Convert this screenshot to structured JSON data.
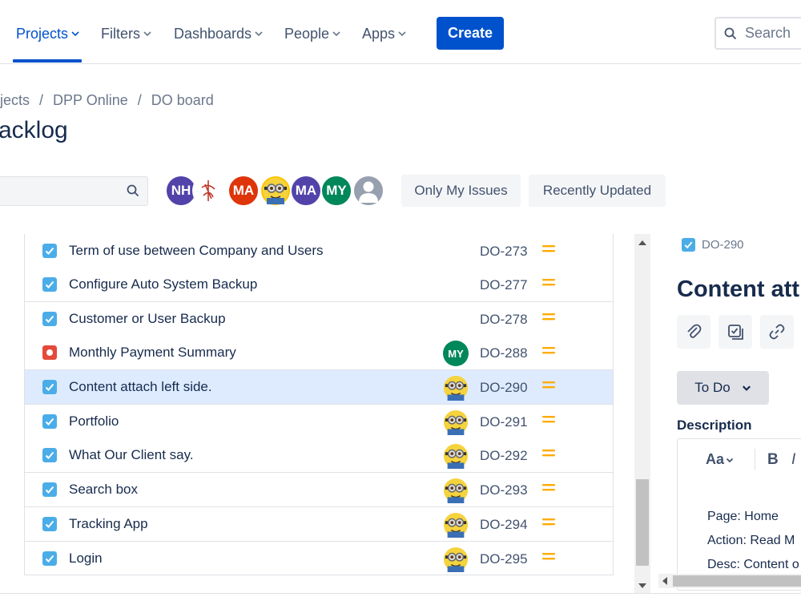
{
  "nav": {
    "items": [
      {
        "label": "Projects",
        "active": true
      },
      {
        "label": "Filters",
        "active": false
      },
      {
        "label": "Dashboards",
        "active": false
      },
      {
        "label": "People",
        "active": false
      },
      {
        "label": "Apps",
        "active": false
      }
    ],
    "create_label": "Create",
    "search_placeholder": "Search"
  },
  "breadcrumb": [
    "jects",
    "/",
    "DPP Online",
    "/",
    "DO board"
  ],
  "page_title": "acklog",
  "filters": {
    "avatars": [
      {
        "initials": "NH",
        "color": "#5243aa"
      },
      {
        "initials": "",
        "color": "#ffffff"
      },
      {
        "initials": "MA",
        "color": "#de350b"
      },
      {
        "initials": "",
        "color": "#ffc400"
      },
      {
        "initials": "MA",
        "color": "#5243aa"
      },
      {
        "initials": "MY",
        "color": "#00875a"
      },
      {
        "initials": "",
        "color": "#97a0af"
      }
    ],
    "only_my_issues": "Only My Issues",
    "recently_updated": "Recently Updated"
  },
  "issues": [
    {
      "summary": "Term of use between Company and Users",
      "key": "DO-273",
      "type": "task",
      "assignee": ""
    },
    {
      "summary": "Configure Auto System Backup",
      "key": "DO-277",
      "type": "task",
      "assignee": ""
    },
    {
      "summary": "Customer or User Backup",
      "key": "DO-278",
      "type": "task",
      "assignee": ""
    },
    {
      "summary": "Monthly Payment Summary",
      "key": "DO-288",
      "type": "bug",
      "assignee": "MY"
    },
    {
      "summary": "Content attach left side.",
      "key": "DO-290",
      "type": "task",
      "assignee": "minion",
      "selected": true
    },
    {
      "summary": "Portfolio",
      "key": "DO-291",
      "type": "task",
      "assignee": "minion"
    },
    {
      "summary": "What Our Client say.",
      "key": "DO-292",
      "type": "task",
      "assignee": "minion"
    },
    {
      "summary": "Search box",
      "key": "DO-293",
      "type": "task",
      "assignee": "minion"
    },
    {
      "summary": "Tracking App",
      "key": "DO-294",
      "type": "task",
      "assignee": "minion"
    },
    {
      "summary": "Login",
      "key": "DO-295",
      "type": "task",
      "assignee": "minion"
    }
  ],
  "detail": {
    "issue_key": "DO-290",
    "title": "Content att",
    "status": "To Do",
    "description_label": "Description",
    "editor": {
      "text_style": "Aa",
      "bold": "B",
      "italic": "I",
      "lines": [
        "Page: Home",
        "Action: Read M",
        "Desc: Content o"
      ]
    }
  },
  "colors": {
    "primary": "#0052cc",
    "task": "#4bade8",
    "bug": "#e5493a",
    "priority_medium": "#ffab00",
    "selected_row": "#deebff"
  }
}
